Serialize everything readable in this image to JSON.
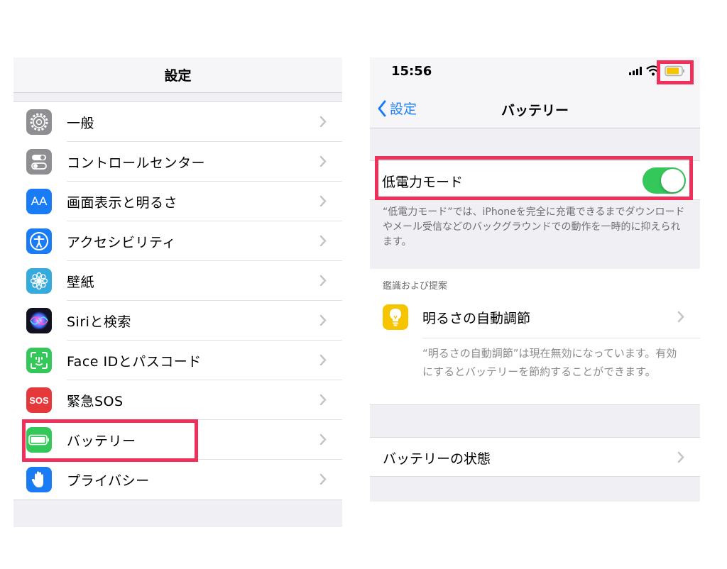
{
  "left": {
    "header_title": "設定",
    "items": [
      {
        "label": "一般",
        "icon": "gear-icon",
        "color": "#8e8e93"
      },
      {
        "label": "コントロールセンター",
        "icon": "control-center-icon",
        "color": "#8e8e93"
      },
      {
        "label": "画面表示と明るさ",
        "icon": "display-aa-icon",
        "color": "#1a7cf5",
        "icon_text": "AA"
      },
      {
        "label": "アクセシビリティ",
        "icon": "accessibility-icon",
        "color": "#1a7cf5"
      },
      {
        "label": "壁紙",
        "icon": "wallpaper-flower-icon",
        "color": "#35aadc"
      },
      {
        "label": "Siriと検索",
        "icon": "siri-icon",
        "color": "#1c1c3a"
      },
      {
        "label": "Face IDとパスコード",
        "icon": "face-id-icon",
        "color": "#34c759"
      },
      {
        "label": "緊急SOS",
        "icon": "sos-icon",
        "color": "#e5383b",
        "icon_text": "SOS"
      },
      {
        "label": "バッテリー",
        "icon": "battery-icon",
        "color": "#34c759"
      },
      {
        "label": "プライバシー",
        "icon": "hand-icon",
        "color": "#1a7cf5"
      }
    ]
  },
  "right": {
    "status_time": "15:56",
    "back_label": "設定",
    "nav_title": "バッテリー",
    "low_power": {
      "label": "低電力モード",
      "enabled": true
    },
    "low_power_footer": "“低電力モード”では、iPhoneを完全に充電できるまでダウンロードやメール受信などのバックグラウンドでの動作を一時的に抑えられます。",
    "insights_header": "鑑識および提案",
    "auto_brightness_label": "明るさの自動調節",
    "auto_brightness_desc": "“明るさの自動調節”は現在無効になっています。有効にするとバッテリーを節約することができます。",
    "battery_health_label": "バッテリーの状態"
  },
  "colors": {
    "highlight": "#f0305a",
    "toggle_on": "#34c759",
    "ios_blue": "#1a7cf5",
    "battery_low_power_yellow": "#f7c500"
  }
}
